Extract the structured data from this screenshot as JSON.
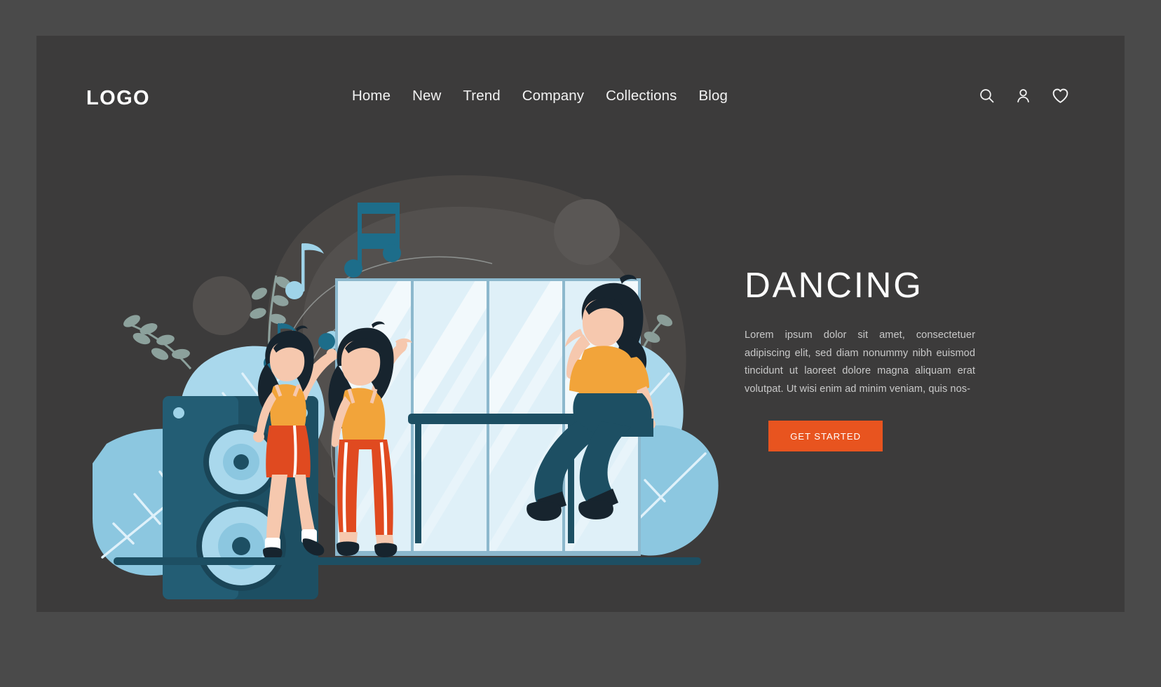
{
  "brand": {
    "logo": "LOGO"
  },
  "nav": {
    "items": [
      {
        "label": "Home"
      },
      {
        "label": "New"
      },
      {
        "label": "Trend"
      },
      {
        "label": "Company"
      },
      {
        "label": "Collections"
      },
      {
        "label": "Blog"
      }
    ]
  },
  "header_icons": [
    {
      "name": "search-icon"
    },
    {
      "name": "user-icon"
    },
    {
      "name": "heart-icon"
    }
  ],
  "hero": {
    "title": "DANCING",
    "paragraph": "Lorem ipsum dolor sit amet, consectetuer adipiscing elit, sed diam nonummy nibh euismod tincidunt ut laoreet dolore magna aliquam erat volutpat. Ut wisi enim ad minim veniam, quis nos-",
    "cta_label": "GET STARTED"
  },
  "illustration": {
    "alt": "Three women dancing in a dance studio with a large speaker, mirrored windows, a ballet barre and music notes",
    "elements": [
      "speaker",
      "mirror-panels",
      "ballet-barre",
      "dancer-left",
      "dancer-center",
      "dancer-seated",
      "music-notes",
      "leaves",
      "floor-line"
    ]
  },
  "colors": {
    "page_background": "#4a4a4a",
    "card_background": "#3c3b3b",
    "accent_orange": "#e8541f",
    "accent_red_orange": "#e04a20",
    "teal_dark": "#1d4f63",
    "teal_mid": "#2b6d85",
    "light_blue": "#9fd3e8",
    "pale_blue": "#dcf0f7",
    "text_light": "#f2f2f2",
    "text_muted": "#c9c9c9",
    "skin": "#f6c8ae",
    "hair_dark": "#17242e"
  }
}
